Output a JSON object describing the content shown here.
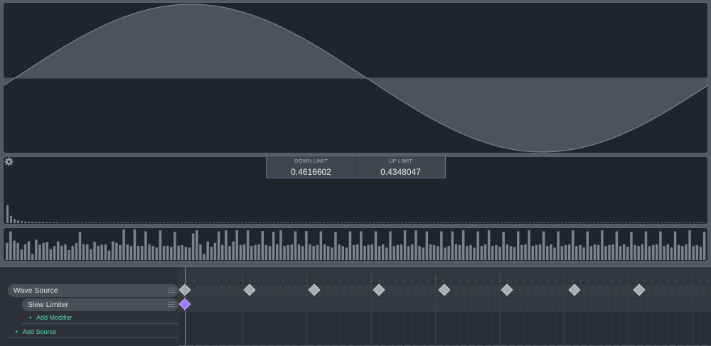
{
  "waveform": {
    "amplitude_range": [
      -1,
      1
    ],
    "cycles_shown": 1.0,
    "shape": "sine"
  },
  "limits": {
    "down": {
      "label": "DOWN LIMIT",
      "value": "0.4616602"
    },
    "up": {
      "label": "UP LIMIT",
      "value": "0.4348047"
    }
  },
  "spectrum": {
    "bins": [
      0.27,
      0.11,
      0.06,
      0.04,
      0.03,
      0.02,
      0.02,
      0.02,
      0.015,
      0.015,
      0.015,
      0.012,
      0.012,
      0.012,
      0.01
    ]
  },
  "bars": {
    "values": [
      0.55,
      0.92,
      0.62,
      0.55,
      0.34,
      0.5,
      0.6,
      0.2,
      0.65,
      0.49,
      0.55,
      0.57,
      0.35,
      0.45,
      0.6,
      0.46,
      0.5,
      0.32,
      0.45,
      0.54,
      0.9,
      0.5,
      0.5,
      0.35,
      0.58,
      0.46,
      0.49,
      0.5,
      0.3,
      0.6,
      0.55,
      0.48,
      0.98,
      0.5,
      0.45,
      0.98,
      0.45,
      0.45,
      0.92,
      0.5,
      0.45,
      0.4,
      0.95,
      0.45,
      0.46,
      0.42,
      0.9,
      0.46,
      0.48,
      0.42,
      0.4,
      0.85,
      0.95,
      0.5,
      0.2,
      0.6,
      0.42,
      0.55,
      0.92,
      0.48,
      0.95,
      0.45,
      0.6,
      0.95,
      0.48,
      0.5,
      0.95,
      0.45,
      0.48,
      0.5,
      0.93,
      0.48,
      0.45,
      0.9,
      0.5,
      0.95,
      0.45,
      0.48,
      0.5,
      0.92,
      0.5,
      0.45,
      0.93,
      0.5,
      0.45,
      0.48,
      0.92,
      0.5,
      0.45,
      0.4,
      0.9,
      0.5,
      0.45,
      0.4,
      0.92,
      0.48,
      0.5,
      0.92,
      0.45,
      0.48,
      0.5,
      0.92,
      0.45,
      0.5,
      0.4,
      0.92,
      0.45,
      0.48,
      0.5,
      0.95,
      0.45,
      0.5,
      0.95,
      0.45,
      0.4,
      0.92,
      0.5,
      0.48,
      0.45,
      0.92,
      0.4,
      0.45,
      0.92,
      0.5,
      0.48,
      0.95,
      0.45,
      0.48,
      0.4,
      0.92,
      0.45,
      0.5,
      0.95,
      0.45,
      0.48,
      0.42,
      0.9,
      0.5,
      0.45,
      0.42,
      0.92,
      0.48,
      0.5,
      0.95,
      0.45,
      0.48,
      0.5,
      0.92,
      0.45,
      0.5,
      0.4,
      0.92,
      0.45,
      0.48,
      0.5,
      0.95,
      0.45,
      0.48,
      0.4,
      0.92,
      0.45,
      0.5,
      0.48,
      0.95,
      0.45,
      0.48,
      0.5,
      0.92,
      0.45,
      0.5,
      0.42,
      0.9,
      0.48,
      0.45,
      0.5,
      0.92,
      0.45,
      0.48,
      0.5,
      0.92,
      0.45,
      0.5,
      0.4,
      0.92,
      0.48,
      0.45,
      0.5,
      0.95,
      0.45,
      0.48,
      0.42,
      0.9
    ]
  },
  "tracks": [
    {
      "label": "Wave Source",
      "keyframes": [
        0.0,
        0.124,
        0.248,
        0.372,
        0.496,
        0.617,
        0.745,
        0.869
      ]
    },
    {
      "label": "Slew Limiter",
      "keyframes": [
        0.0
      ]
    }
  ],
  "actions": {
    "add_modifier": "Add Modifier",
    "add_source": "Add Source",
    "plus_glyph": "+"
  },
  "icons": {
    "settings": "gear-icon",
    "drag": "drag-handle-icon"
  },
  "colors": {
    "accent": "#a07cf6",
    "add_text": "#54dcb2",
    "panel_bg": "#21252b",
    "wave_fill": "#4f5359"
  }
}
